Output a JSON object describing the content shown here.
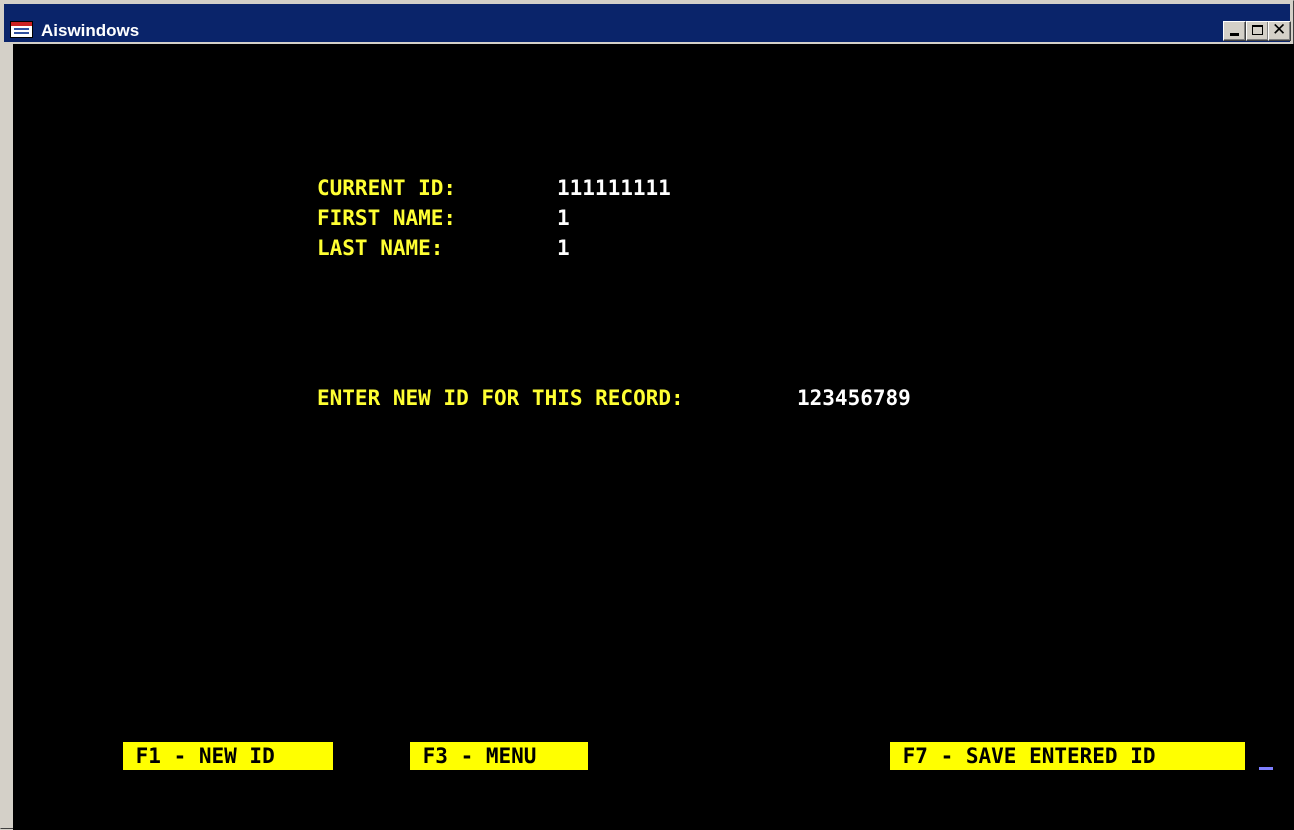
{
  "window": {
    "title": "Aiswindows",
    "icon": "app-window-icon",
    "controls": [
      "minimize-icon",
      "maximize-icon",
      "close-icon"
    ]
  },
  "record": {
    "current_id_label": "CURRENT ID:",
    "current_id_value": "111111111",
    "first_name_label": "FIRST NAME:",
    "first_name_value": "1",
    "last_name_label": "LAST NAME:",
    "last_name_value": "1"
  },
  "prompt": {
    "label": "ENTER NEW ID FOR THIS RECORD:",
    "value": "123456789"
  },
  "function_keys": {
    "f1": " F1 - NEW ID",
    "f3": " F3 - MENU",
    "f7": " F7 - SAVE ENTERED ID"
  },
  "colors": {
    "label": "#ffff33",
    "value": "#ffffff",
    "fkey_bg": "#ffff00",
    "console_bg": "#000000",
    "titlebar": "#0a246a"
  }
}
